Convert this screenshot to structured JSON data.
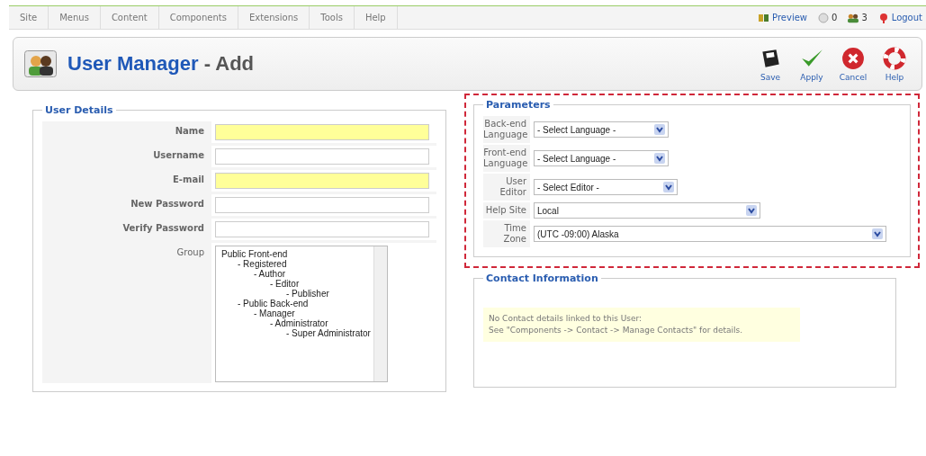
{
  "menu": [
    "Site",
    "Menus",
    "Content",
    "Components",
    "Extensions",
    "Tools",
    "Help"
  ],
  "status": {
    "preview": "Preview",
    "messages": "0",
    "users": "3",
    "logout": "Logout"
  },
  "header": {
    "title": "User Manager",
    "subtitle": "- Add"
  },
  "toolbar": [
    {
      "kind": "save",
      "label": "Save"
    },
    {
      "kind": "apply",
      "label": "Apply"
    },
    {
      "kind": "cancel",
      "label": "Cancel"
    },
    {
      "kind": "help",
      "label": "Help"
    }
  ],
  "user_details": {
    "legend": "User Details",
    "fields": [
      {
        "label": "Name",
        "required": true
      },
      {
        "label": "Username",
        "required": false
      },
      {
        "label": "E-mail",
        "required": true
      },
      {
        "label": "New Password",
        "required": false
      },
      {
        "label": "Verify Password",
        "required": false
      }
    ],
    "group": {
      "label": "Group",
      "items": [
        {
          "label": "Public Front-end",
          "children": [
            {
              "label": "- Registered",
              "children": [
                {
                  "label": "- Author",
                  "children": [
                    {
                      "label": "- Editor",
                      "children": [
                        {
                          "label": "- Publisher"
                        }
                      ]
                    }
                  ]
                }
              ]
            },
            {
              "label": "- Public Back-end",
              "children": [
                {
                  "label": "- Manager",
                  "children": [
                    {
                      "label": "- Administrator",
                      "children": [
                        {
                          "label": "- Super Administrator"
                        }
                      ]
                    }
                  ]
                }
              ]
            }
          ]
        }
      ]
    }
  },
  "parameters": {
    "legend": "Parameters",
    "rows": [
      {
        "label": "Back-end Language",
        "value": "- Select Language -"
      },
      {
        "label": "Front-end Language",
        "value": "- Select Language -"
      },
      {
        "label": "User Editor",
        "value": "- Select Editor -"
      },
      {
        "label": "Help Site",
        "value": "Local"
      },
      {
        "label": "Time Zone",
        "value": "(UTC -09:00) Alaska"
      }
    ]
  },
  "contact": {
    "legend": "Contact Information",
    "lines": [
      "No Contact details linked to this User:",
      "See \"Components -> Contact -> Manage Contacts\" for details."
    ]
  }
}
